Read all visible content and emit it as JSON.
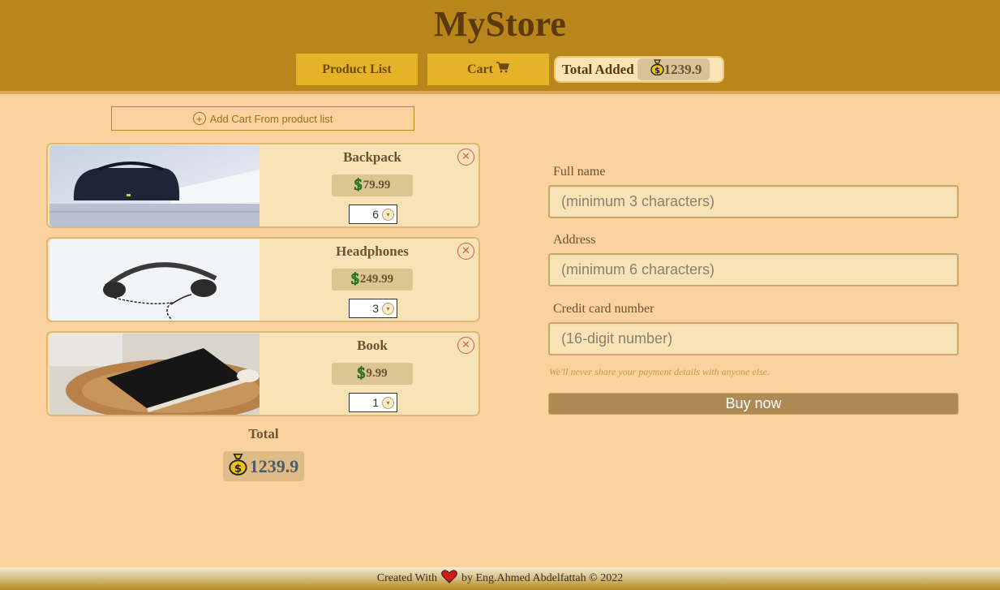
{
  "header": {
    "brand": "MyStore",
    "nav": {
      "products_label": "Product List",
      "cart_label": "Cart"
    },
    "total_added": {
      "label": "Total Added",
      "value": "1239.9"
    }
  },
  "cart": {
    "add_link": "Add Cart From product list",
    "items": [
      {
        "name": "Backpack",
        "price": "79.99",
        "qty": "6",
        "image": "backpack-photo"
      },
      {
        "name": "Headphones",
        "price": "249.99",
        "qty": "3",
        "image": "headphones-photo"
      },
      {
        "name": "Book",
        "price": "9.99",
        "qty": "1",
        "image": "book-photo"
      }
    ],
    "total_label": "Total",
    "total_value": "1239.9"
  },
  "form": {
    "fullname": {
      "label": "Full name",
      "placeholder": "(minimum 3 characters)"
    },
    "address": {
      "label": "Address",
      "placeholder": "(minimum 6 characters)"
    },
    "card": {
      "label": "Credit card number",
      "placeholder": "(16-digit number)"
    },
    "privacy": "We'll never share your payment details with anyone else.",
    "buy_label": "Buy now"
  },
  "footer": {
    "prefix": "Created With",
    "suffix": "by Eng.Ahmed Abdelfattah © 2022"
  },
  "colors": {
    "header_bg": "#b8861b",
    "page_bg": "#fbd19e",
    "nav_button": "#e6b227",
    "remove": "#e05555",
    "dollar": "#1f9d1f"
  }
}
